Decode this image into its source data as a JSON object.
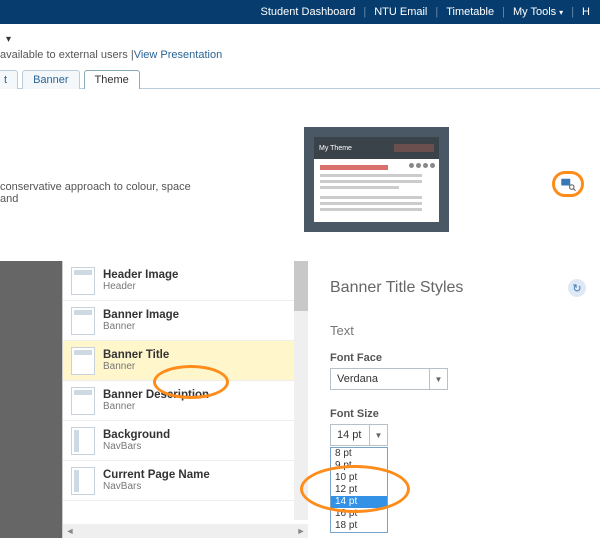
{
  "topnav": {
    "items": [
      "Student Dashboard",
      "NTU Email",
      "Timetable",
      "My Tools",
      "H"
    ]
  },
  "availLine": {
    "text": "available to external users ",
    "link": "View Presentation"
  },
  "tabs": {
    "t0": "t",
    "t1": "Banner",
    "t2": "Theme"
  },
  "theme": {
    "desc": "conservative approach to colour, space and",
    "thumbTitle": "My Theme"
  },
  "list": {
    "items": [
      {
        "title": "Header Image",
        "sub": "Header",
        "ico": "top"
      },
      {
        "title": "Banner Image",
        "sub": "Banner",
        "ico": "top"
      },
      {
        "title": "Banner Title",
        "sub": "Banner",
        "ico": "top",
        "selected": true
      },
      {
        "title": "Banner Description",
        "sub": "Banner",
        "ico": "top"
      },
      {
        "title": "Background",
        "sub": "NavBars",
        "ico": "left"
      },
      {
        "title": "Current Page Name",
        "sub": "NavBars",
        "ico": "left"
      }
    ]
  },
  "right": {
    "title": "Banner Title Styles",
    "section": "Text",
    "fontFaceLabel": "Font Face",
    "fontFaceValue": "Verdana",
    "fontSizeLabel": "Font Size",
    "fontSizeValue": "14 pt",
    "options": [
      "8 pt",
      "9 pt",
      "10 pt",
      "12 pt",
      "14 pt",
      "16 pt",
      "18 pt"
    ]
  }
}
